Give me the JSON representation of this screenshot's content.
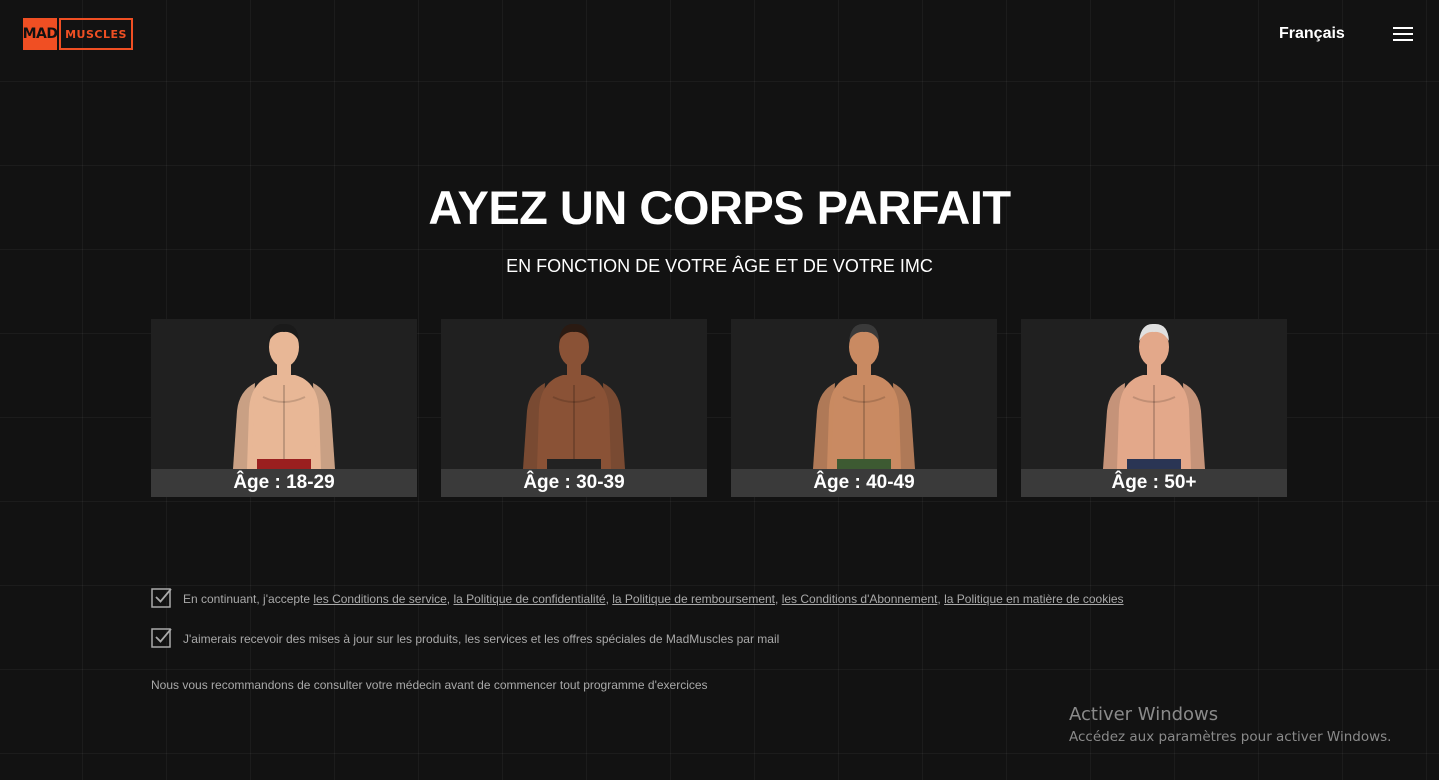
{
  "header": {
    "logo_left": "MAD",
    "logo_right": "MUSCLES",
    "language": "Français",
    "menu_icon": "hamburger-menu-icon"
  },
  "hero": {
    "title": "AYEZ UN CORPS PARFAIT",
    "subtitle": "EN FONCTION DE VOTRE ÂGE ET DE VOTRE IMC"
  },
  "age_cards": [
    {
      "label": "Âge : 18-29",
      "skin": "#e8b796",
      "hair": "#1a1a1a",
      "shorts": "#9a1f1f"
    },
    {
      "label": "Âge : 30-39",
      "skin": "#8a5236",
      "hair": "#2a1a12",
      "shorts": "#222222"
    },
    {
      "label": "Âge : 40-49",
      "skin": "#c98a62",
      "hair": "#3a3a3a",
      "shorts": "#3d5a32"
    },
    {
      "label": "Âge : 50+",
      "skin": "#e3a88a",
      "hair": "#e0e0e0",
      "shorts": "#2a3554"
    }
  ],
  "consents": {
    "terms_prefix": "En continuant, j'accepte ",
    "terms_links": [
      "les Conditions de service",
      "la Politique de confidentialité",
      "la Politique de remboursement",
      "les Conditions d'Abonnement",
      "la Politique en matière de cookies"
    ],
    "separator": ", ",
    "newsletter": "J'aimerais recevoir des mises à jour sur les produits, les services et les offres spéciales de MadMuscles par mail",
    "checkbox_icon": "checkbox-checked-icon"
  },
  "disclaimer": "Nous vous recommandons de consulter votre médecin avant de commencer tout programme d'exercices",
  "watermark": {
    "title": "Activer Windows",
    "subtitle": "Accédez aux paramètres pour activer Windows."
  }
}
